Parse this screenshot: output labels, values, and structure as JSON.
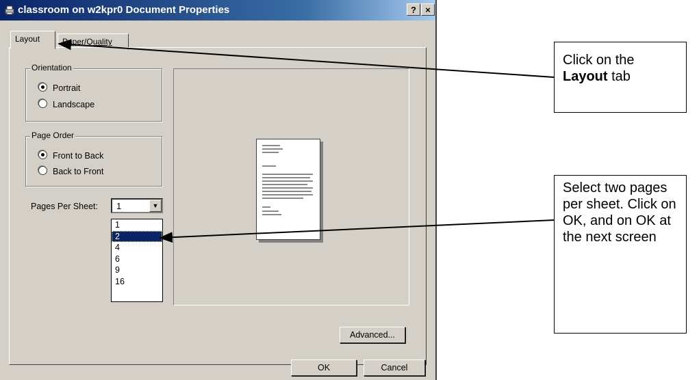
{
  "window": {
    "title": "classroom on w2kpr0 Document Properties",
    "help_label": "?",
    "close_label": "×"
  },
  "tabs": [
    {
      "label": "Layout",
      "active": true
    },
    {
      "label": "Paper/Quality",
      "active": false
    }
  ],
  "orientation": {
    "legend": "Orientation",
    "options": [
      {
        "label": "Portrait",
        "selected": true
      },
      {
        "label": "Landscape",
        "selected": false
      }
    ]
  },
  "page_order": {
    "legend": "Page Order",
    "options": [
      {
        "label": "Front to Back",
        "selected": true
      },
      {
        "label": "Back to Front",
        "selected": false
      }
    ]
  },
  "pages_per_sheet": {
    "label": "Pages Per Sheet:",
    "value": "1",
    "options": [
      "1",
      "2",
      "4",
      "6",
      "9",
      "16"
    ],
    "highlighted": "2"
  },
  "buttons": {
    "advanced": "Advanced...",
    "ok": "OK",
    "cancel": "Cancel"
  },
  "callouts": {
    "layout": {
      "text_before": "Click on the",
      "bold": "Layout",
      "text_after": " tab"
    },
    "select": {
      "text": "Select two pages per sheet. Click on OK, and on OK at the next screen"
    }
  },
  "colors": {
    "title_bar": "#0a246a",
    "dialog_bg": "#d4d0c8",
    "selection": "#0a246a"
  }
}
